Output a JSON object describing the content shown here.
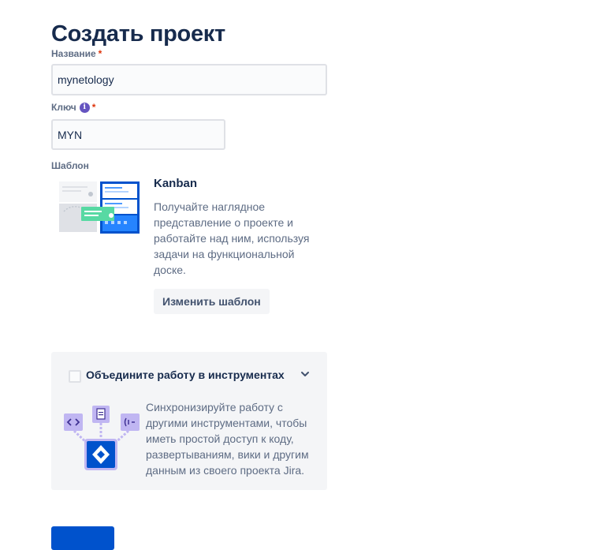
{
  "page": {
    "title": "Создать проект"
  },
  "form": {
    "name": {
      "label": "Название",
      "required_mark": "*",
      "value": "mynetology"
    },
    "key": {
      "label": "Ключ",
      "info_icon_glyph": "i",
      "required_mark": "*",
      "value": "MYN"
    },
    "template": {
      "label": "Шаблон",
      "title": "Kanban",
      "description": "Получайте наглядное представление о проекте и работайте над ним, используя задачи на функциональной доске.",
      "change_button_label": "Изменить шаблон",
      "thumbnail_icon": "kanban-board-icon"
    }
  },
  "integrations": {
    "title": "Объедините работу в инструментах",
    "description": "Синхронизируйте работу с другими инструментами, чтобы иметь простой доступ к коду, развертываниям, вики и другим данным из своего проекта Jira.",
    "checked": false,
    "icons": [
      "code-icon",
      "document-icon",
      "deployment-icon",
      "jira-icon",
      "chevron-down-icon"
    ]
  },
  "colors": {
    "accent": "#0052cc",
    "info": "#6554c0",
    "required": "#de350b",
    "panel_bg": "#f4f5f7"
  }
}
